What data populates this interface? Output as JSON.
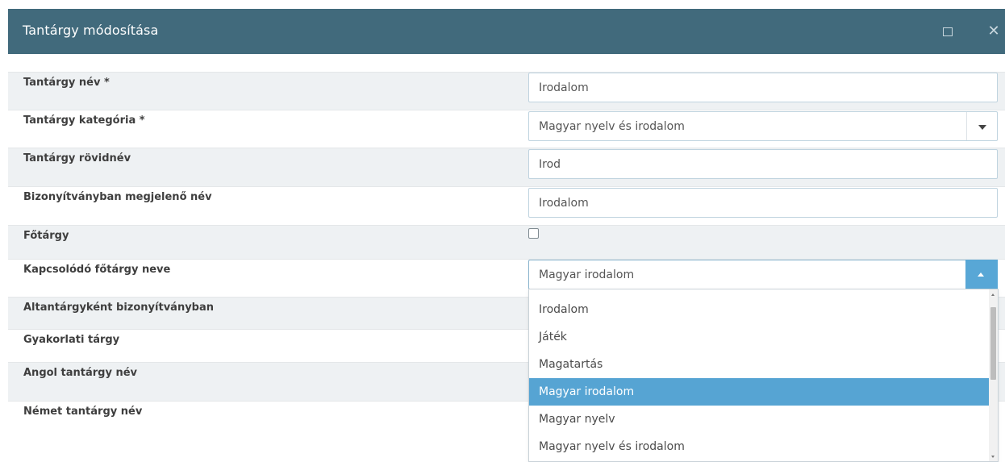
{
  "window": {
    "title": "Tantárgy módosítása",
    "maximize_icon": "maximize-icon",
    "close_icon": "close-icon"
  },
  "form": {
    "rows": [
      {
        "label": "Tantárgy név *",
        "value": "Irodalom"
      },
      {
        "label": "Tantárgy kategória *",
        "value": "Magyar nyelv és irodalom"
      },
      {
        "label": "Tantárgy rövidnév",
        "value": "Irod"
      },
      {
        "label": "Bizonyítványban megjelenő név",
        "value": "Irodalom"
      },
      {
        "label": "Főtárgy",
        "checked": false
      },
      {
        "label": "Kapcsolódó főtárgy neve",
        "value": "Magyar irodalom"
      },
      {
        "label": "Altantárgyként bizonyítványban"
      },
      {
        "label": "Gyakorlati tárgy"
      },
      {
        "label": "Angol tantárgy név"
      },
      {
        "label": "Német tantárgy név"
      }
    ]
  },
  "dropdown": {
    "options": [
      "Irodalom",
      "Játék",
      "Magatartás",
      "Magyar irodalom",
      "Magyar nyelv",
      "Magyar nyelv és irodalom"
    ],
    "selected": "Magyar irodalom"
  },
  "colors": {
    "titlebar": "#416a7c",
    "selected_option": "#56a4d3",
    "row_shade": "#eef1f3"
  }
}
